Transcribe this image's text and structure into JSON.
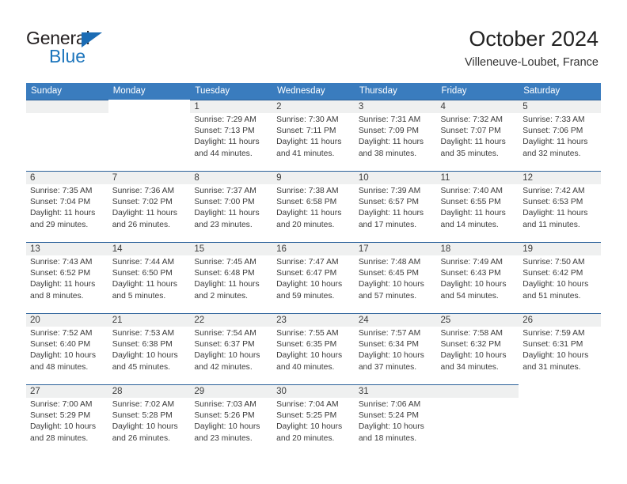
{
  "logo": {
    "word_top": "General",
    "word_bottom": "Blue",
    "triangle_color": "#1c6cb4",
    "bottom_color": "#1c75bc"
  },
  "header": {
    "title": "October 2024",
    "subtitle": "Villeneuve-Loubet, France"
  },
  "theme": {
    "header_blue": "#3a7cbe",
    "cell_strip_gray": "#eff0f0",
    "cell_border_blue": "#2a6099",
    "text_color": "#3b3b3b"
  },
  "weekdays": [
    "Sunday",
    "Monday",
    "Tuesday",
    "Wednesday",
    "Thursday",
    "Friday",
    "Saturday"
  ],
  "labels": {
    "sunrise": "Sunrise:",
    "sunset": "Sunset:",
    "daylight": "Daylight:"
  },
  "weeks": [
    [
      {
        "day": "",
        "blank": true,
        "strip": true
      },
      {
        "day": "",
        "blank": true,
        "strip": false
      },
      {
        "day": "1",
        "sunrise": "Sunrise: 7:29 AM",
        "sunset": "Sunset: 7:13 PM",
        "daylight": "Daylight: 11 hours and 44 minutes."
      },
      {
        "day": "2",
        "sunrise": "Sunrise: 7:30 AM",
        "sunset": "Sunset: 7:11 PM",
        "daylight": "Daylight: 11 hours and 41 minutes."
      },
      {
        "day": "3",
        "sunrise": "Sunrise: 7:31 AM",
        "sunset": "Sunset: 7:09 PM",
        "daylight": "Daylight: 11 hours and 38 minutes."
      },
      {
        "day": "4",
        "sunrise": "Sunrise: 7:32 AM",
        "sunset": "Sunset: 7:07 PM",
        "daylight": "Daylight: 11 hours and 35 minutes."
      },
      {
        "day": "5",
        "sunrise": "Sunrise: 7:33 AM",
        "sunset": "Sunset: 7:06 PM",
        "daylight": "Daylight: 11 hours and 32 minutes."
      }
    ],
    [
      {
        "day": "6",
        "sunrise": "Sunrise: 7:35 AM",
        "sunset": "Sunset: 7:04 PM",
        "daylight": "Daylight: 11 hours and 29 minutes."
      },
      {
        "day": "7",
        "sunrise": "Sunrise: 7:36 AM",
        "sunset": "Sunset: 7:02 PM",
        "daylight": "Daylight: 11 hours and 26 minutes."
      },
      {
        "day": "8",
        "sunrise": "Sunrise: 7:37 AM",
        "sunset": "Sunset: 7:00 PM",
        "daylight": "Daylight: 11 hours and 23 minutes."
      },
      {
        "day": "9",
        "sunrise": "Sunrise: 7:38 AM",
        "sunset": "Sunset: 6:58 PM",
        "daylight": "Daylight: 11 hours and 20 minutes."
      },
      {
        "day": "10",
        "sunrise": "Sunrise: 7:39 AM",
        "sunset": "Sunset: 6:57 PM",
        "daylight": "Daylight: 11 hours and 17 minutes."
      },
      {
        "day": "11",
        "sunrise": "Sunrise: 7:40 AM",
        "sunset": "Sunset: 6:55 PM",
        "daylight": "Daylight: 11 hours and 14 minutes."
      },
      {
        "day": "12",
        "sunrise": "Sunrise: 7:42 AM",
        "sunset": "Sunset: 6:53 PM",
        "daylight": "Daylight: 11 hours and 11 minutes."
      }
    ],
    [
      {
        "day": "13",
        "sunrise": "Sunrise: 7:43 AM",
        "sunset": "Sunset: 6:52 PM",
        "daylight": "Daylight: 11 hours and 8 minutes."
      },
      {
        "day": "14",
        "sunrise": "Sunrise: 7:44 AM",
        "sunset": "Sunset: 6:50 PM",
        "daylight": "Daylight: 11 hours and 5 minutes."
      },
      {
        "day": "15",
        "sunrise": "Sunrise: 7:45 AM",
        "sunset": "Sunset: 6:48 PM",
        "daylight": "Daylight: 11 hours and 2 minutes."
      },
      {
        "day": "16",
        "sunrise": "Sunrise: 7:47 AM",
        "sunset": "Sunset: 6:47 PM",
        "daylight": "Daylight: 10 hours and 59 minutes."
      },
      {
        "day": "17",
        "sunrise": "Sunrise: 7:48 AM",
        "sunset": "Sunset: 6:45 PM",
        "daylight": "Daylight: 10 hours and 57 minutes."
      },
      {
        "day": "18",
        "sunrise": "Sunrise: 7:49 AM",
        "sunset": "Sunset: 6:43 PM",
        "daylight": "Daylight: 10 hours and 54 minutes."
      },
      {
        "day": "19",
        "sunrise": "Sunrise: 7:50 AM",
        "sunset": "Sunset: 6:42 PM",
        "daylight": "Daylight: 10 hours and 51 minutes."
      }
    ],
    [
      {
        "day": "20",
        "sunrise": "Sunrise: 7:52 AM",
        "sunset": "Sunset: 6:40 PM",
        "daylight": "Daylight: 10 hours and 48 minutes."
      },
      {
        "day": "21",
        "sunrise": "Sunrise: 7:53 AM",
        "sunset": "Sunset: 6:38 PM",
        "daylight": "Daylight: 10 hours and 45 minutes."
      },
      {
        "day": "22",
        "sunrise": "Sunrise: 7:54 AM",
        "sunset": "Sunset: 6:37 PM",
        "daylight": "Daylight: 10 hours and 42 minutes."
      },
      {
        "day": "23",
        "sunrise": "Sunrise: 7:55 AM",
        "sunset": "Sunset: 6:35 PM",
        "daylight": "Daylight: 10 hours and 40 minutes."
      },
      {
        "day": "24",
        "sunrise": "Sunrise: 7:57 AM",
        "sunset": "Sunset: 6:34 PM",
        "daylight": "Daylight: 10 hours and 37 minutes."
      },
      {
        "day": "25",
        "sunrise": "Sunrise: 7:58 AM",
        "sunset": "Sunset: 6:32 PM",
        "daylight": "Daylight: 10 hours and 34 minutes."
      },
      {
        "day": "26",
        "sunrise": "Sunrise: 7:59 AM",
        "sunset": "Sunset: 6:31 PM",
        "daylight": "Daylight: 10 hours and 31 minutes."
      }
    ],
    [
      {
        "day": "27",
        "sunrise": "Sunrise: 7:00 AM",
        "sunset": "Sunset: 5:29 PM",
        "daylight": "Daylight: 10 hours and 28 minutes."
      },
      {
        "day": "28",
        "sunrise": "Sunrise: 7:02 AM",
        "sunset": "Sunset: 5:28 PM",
        "daylight": "Daylight: 10 hours and 26 minutes."
      },
      {
        "day": "29",
        "sunrise": "Sunrise: 7:03 AM",
        "sunset": "Sunset: 5:26 PM",
        "daylight": "Daylight: 10 hours and 23 minutes."
      },
      {
        "day": "30",
        "sunrise": "Sunrise: 7:04 AM",
        "sunset": "Sunset: 5:25 PM",
        "daylight": "Daylight: 10 hours and 20 minutes."
      },
      {
        "day": "31",
        "sunrise": "Sunrise: 7:06 AM",
        "sunset": "Sunset: 5:24 PM",
        "daylight": "Daylight: 10 hours and 18 minutes."
      },
      {
        "day": "",
        "blank": true,
        "strip": true
      },
      {
        "day": "",
        "blank": true,
        "strip": false
      }
    ]
  ]
}
